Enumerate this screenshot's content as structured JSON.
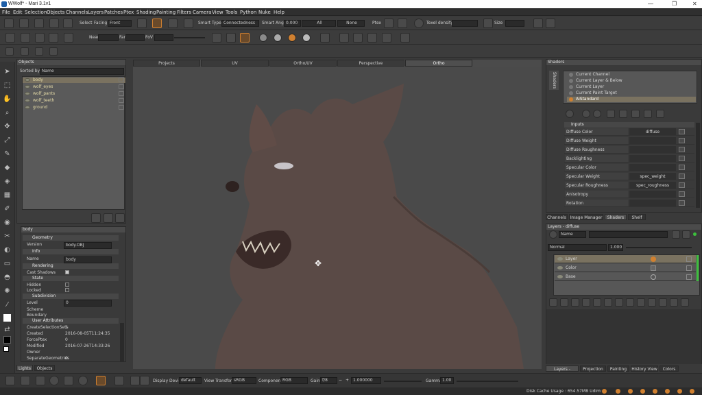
{
  "window": {
    "title": "WWolf* - Mari 3.1v1"
  },
  "menu": [
    "File",
    "Edit",
    "Selection",
    "Objects",
    "Channels",
    "Layers",
    "Patches",
    "Ptex",
    "Shading",
    "Painting",
    "Filters",
    "Camera",
    "View",
    "Tools",
    "Python",
    "Nuke",
    "Help"
  ],
  "toolbar1": {
    "select_label": "Select",
    "facing_label": "Facing",
    "facing_value": "Front",
    "smart_type_label": "Smart Type:",
    "smart_type_value": "Connectedness",
    "smart_angle_label": "Smart Angle",
    "smart_angle_value": "0.000",
    "all_label": "All",
    "none_label": "None",
    "ptex_label": "Ptex",
    "texel_density_label": "Texel density",
    "size_label": "Size"
  },
  "toolbar2": {
    "near_label": "Near",
    "far_label": "Far",
    "fov_label": "FoV"
  },
  "objects_panel": {
    "header": "Objects",
    "sorted_by_label": "Sorted by",
    "sorted_by_value": "Name",
    "items": [
      "body",
      "wolf_eyes",
      "wolf_pants",
      "wolf_teeth",
      "ground"
    ]
  },
  "properties": {
    "header": "body",
    "sections": {
      "geometry": "Geometry",
      "info": "Info",
      "rendering": "Rendering",
      "state": "State",
      "subdivision": "Subdivision",
      "user_attributes": "User Attributes"
    },
    "version_label": "Version",
    "version_value": "body.OBJ",
    "name_label": "Name",
    "name_value": "body",
    "cast_shadows_label": "Cast Shadows",
    "hidden_label": "Hidden",
    "locked_label": "Locked",
    "level_label": "Level",
    "level_value": "0",
    "scheme_label": "Scheme",
    "boundary_label": "Boundary",
    "attrs": [
      {
        "k": "CreateSelectionSets",
        "v": "1"
      },
      {
        "k": "Created",
        "v": "2016-08-05T11:24:35"
      },
      {
        "k": "ForcePtex",
        "v": "0"
      },
      {
        "k": "Modified",
        "v": "2016-07-26T14:33:26"
      },
      {
        "k": "Owner",
        "v": ""
      },
      {
        "k": "SeparateGeometries",
        "v": "0"
      }
    ]
  },
  "left_bottom_tabs": [
    "Lights",
    "Objects"
  ],
  "viewport_tabs": [
    "Projects",
    "UV",
    "Ortho/UV",
    "Perspective",
    "Ortho"
  ],
  "viewport_active_tab": "Ortho",
  "shaders_panel": {
    "header": "Shaders",
    "side_tab": "Shaders",
    "items": [
      "Current Channel",
      "Current Layer & Below",
      "Current Layer",
      "Current Paint Target",
      "AiStandard"
    ],
    "selected": "AiStandard",
    "inputs_header": "Inputs",
    "inputs": [
      {
        "k": "Diffuse Color",
        "v": "diffuse"
      },
      {
        "k": "Diffuse Weight",
        "v": ""
      },
      {
        "k": "Diffuse Roughness",
        "v": ""
      },
      {
        "k": "Backlighting",
        "v": ""
      },
      {
        "k": "Specular Color",
        "v": ""
      },
      {
        "k": "Specular Weight",
        "v": "spec_weight"
      },
      {
        "k": "Specular Roughness",
        "v": "spec_roughness"
      },
      {
        "k": "Anisotropy",
        "v": ""
      },
      {
        "k": "Rotation",
        "v": ""
      }
    ],
    "tabs": [
      "Channels",
      "Image Manager",
      "Shaders",
      "Shelf"
    ]
  },
  "layers_panel": {
    "header": "Layers - diffuse",
    "filter_value": "Name",
    "blend_mode": "Normal",
    "opacity": "1.000",
    "items": [
      "Layer",
      "Color",
      "Base"
    ],
    "tabs": [
      "Layers - diffuse",
      "Projection",
      "Painting",
      "History View",
      "Colors"
    ]
  },
  "bottom_bar": {
    "display_device_label": "Display Device",
    "display_device_value": "default",
    "view_transform_label": "View Transform",
    "view_transform_value": "sRGB",
    "component_label": "Component",
    "component_value": "RGB",
    "gain_label": "Gain",
    "gain_value": "f/8",
    "gain_number": "1.000000",
    "gamma_label": "Gamma",
    "gamma_value": "1.00"
  },
  "status": {
    "disk_cache": "Disk Cache Usage : 654.57MB Udim:"
  }
}
